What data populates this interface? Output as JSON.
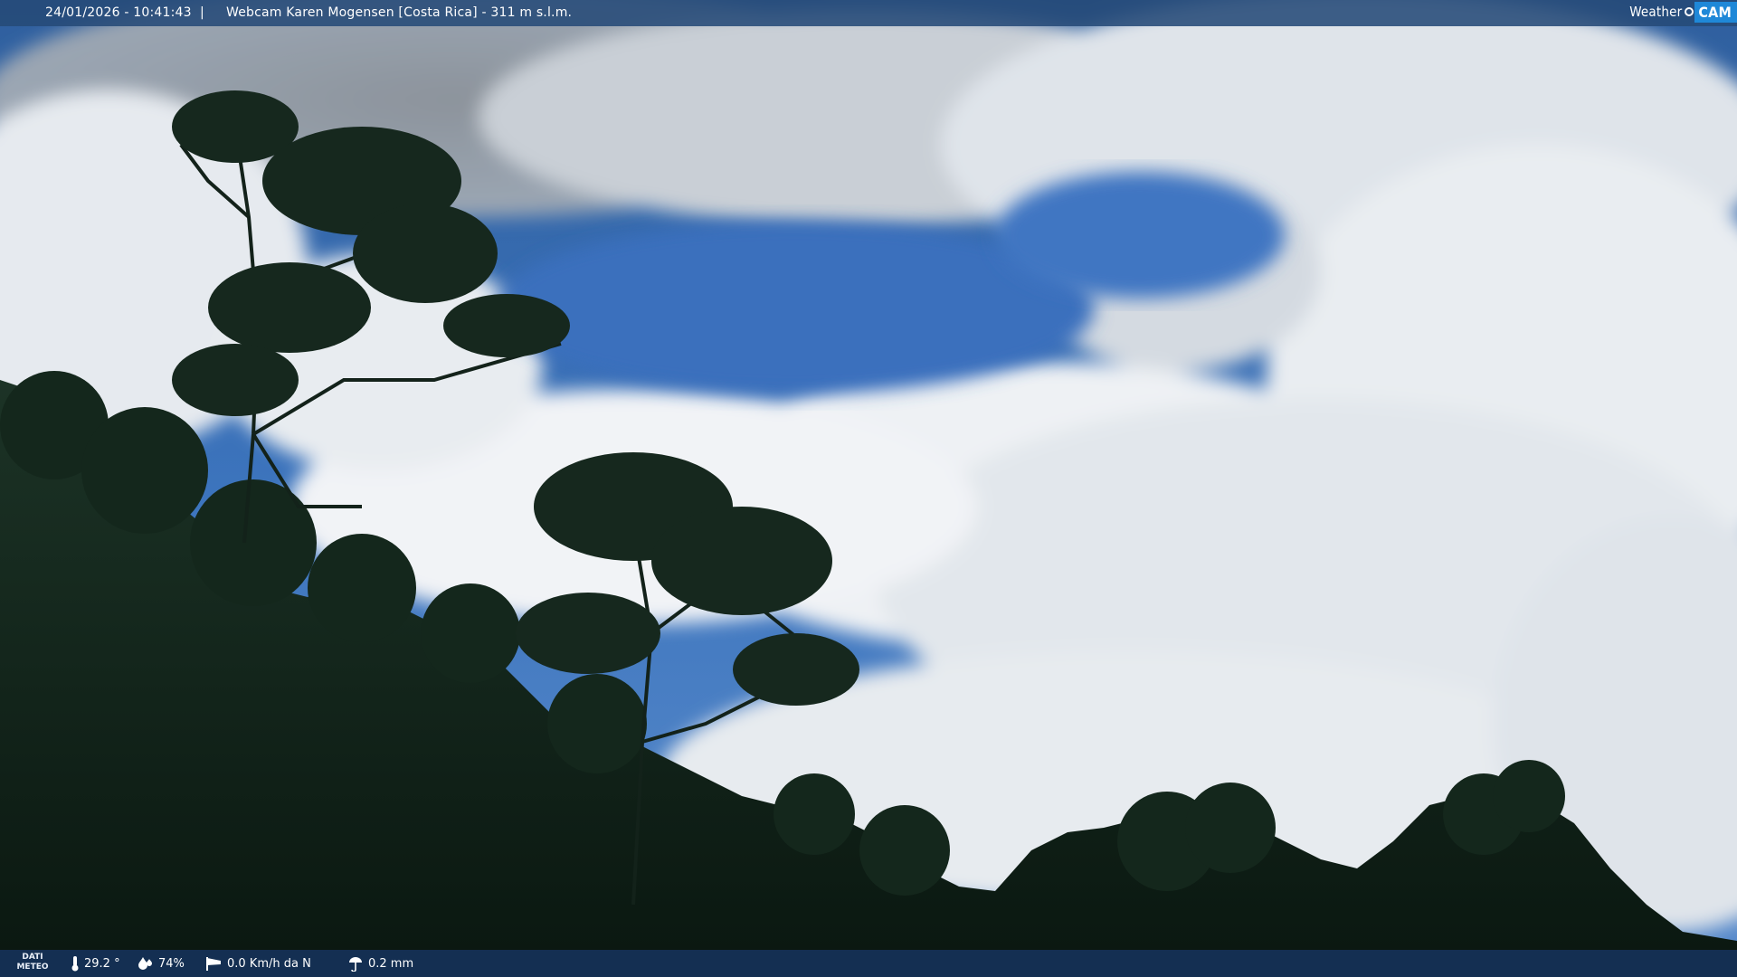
{
  "top_bar": {
    "timestamp": "24/01/2026 - 10:41:43",
    "separator": "|",
    "title": "Webcam Karen Mogensen [Costa Rica]  - 311 m s.l.m."
  },
  "logo": {
    "text_left": "Weather",
    "text_right": "CAM"
  },
  "bottom_bar": {
    "label_line1": "DATI",
    "label_line2": "METEO",
    "temperature": "29.2 °",
    "humidity": "74%",
    "wind": "0.0 Km/h da N",
    "rain": "0.2 mm"
  },
  "icons": {
    "temperature": "thermometer-icon",
    "humidity": "droplet-icon",
    "wind": "wind-sock-icon",
    "rain": "rain-gauge-icon"
  },
  "colors": {
    "bar_top": "#264a78",
    "bar_bottom": "#163258",
    "logo_accent": "#1f88d8",
    "sky": "#3a6fb8",
    "cloud": "#e9edf2",
    "foliage": "#10201a"
  }
}
